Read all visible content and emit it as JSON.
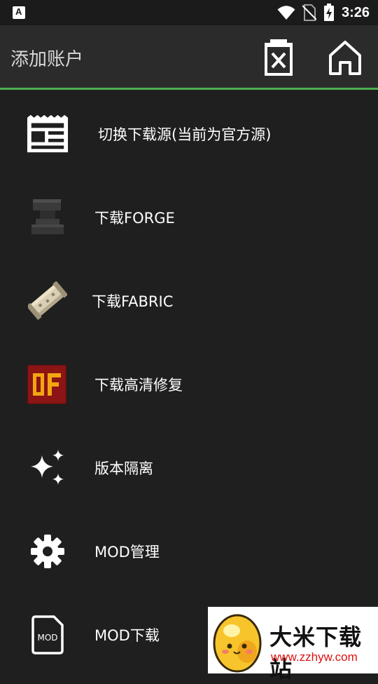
{
  "status_bar": {
    "app_icon_letter": "A",
    "time": "3:26",
    "icons": [
      "wifi-icon",
      "no-sim-icon",
      "battery-charging-icon"
    ]
  },
  "app_bar": {
    "title": "添加账户",
    "actions": [
      "delete-icon",
      "home-icon"
    ],
    "accent_color": "#4caf50"
  },
  "menu": {
    "items": [
      {
        "label": "切换下载源(当前为官方源)",
        "icon": "news-icon"
      },
      {
        "label": "下载FORGE",
        "icon": "anvil-icon"
      },
      {
        "label": "下载FABRIC",
        "icon": "fabric-scroll-icon"
      },
      {
        "label": "下载高清修复",
        "icon": "optifine-icon"
      },
      {
        "label": "版本隔离",
        "icon": "sparkle-icon"
      },
      {
        "label": "MOD管理",
        "icon": "gear-icon"
      },
      {
        "label": "MOD下载",
        "icon": "mod-file-icon"
      }
    ]
  },
  "watermark": {
    "title": "大米下载站",
    "url": "www.zzhyw.com"
  },
  "colors": {
    "background": "#1f1f1f",
    "app_bar": "#2b2b2b",
    "accent": "#4caf50",
    "text": "#ffffff"
  }
}
